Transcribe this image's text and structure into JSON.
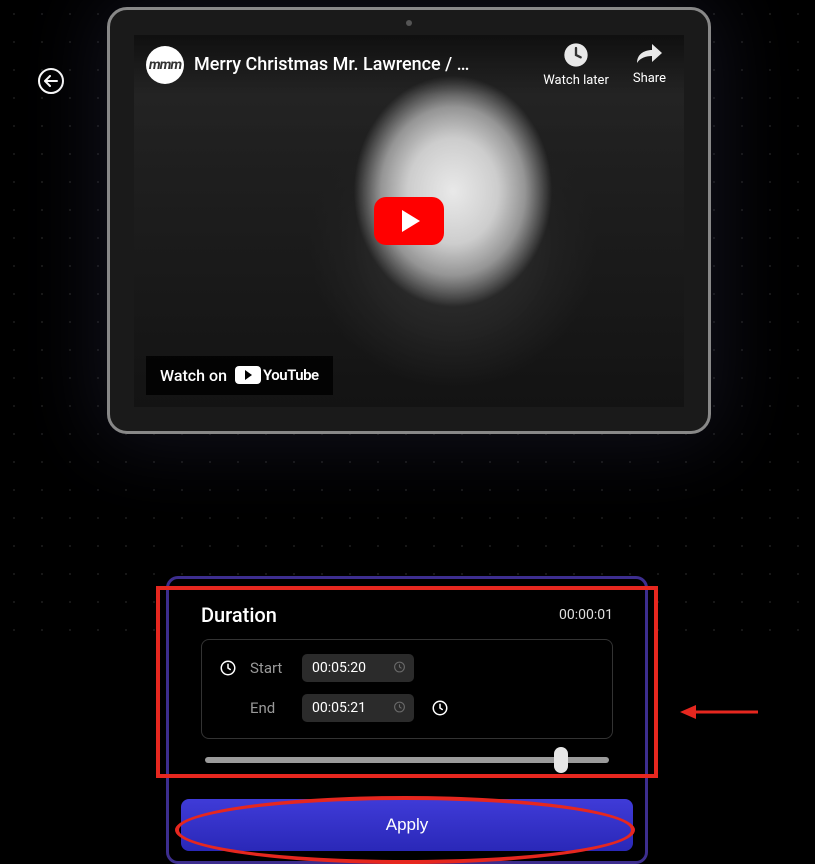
{
  "colors": {
    "accent_red": "#e6271f",
    "accent_purple": "#3d2e8f",
    "apply_gradient_top": "#3f3bd8",
    "apply_gradient_bottom": "#2a28b8",
    "youtube_red": "#ff0000"
  },
  "video": {
    "channel_avatar_text": "mmm",
    "title": "Merry Christmas Mr. Lawrence / …",
    "actions": {
      "watch_later": "Watch later",
      "share": "Share"
    },
    "watch_on": {
      "prefix": "Watch on",
      "platform": "YouTube"
    }
  },
  "panel": {
    "title": "Duration",
    "total": "00:00:01",
    "start": {
      "label": "Start",
      "value": "00:05:20"
    },
    "end": {
      "label": "End",
      "value": "00:05:21"
    },
    "slider_position_pct": 88,
    "apply_label": "Apply"
  },
  "icons": {
    "back": "arrow-left-circle",
    "watch_later": "clock",
    "share": "share-arrow",
    "play": "play",
    "clock": "clock"
  }
}
